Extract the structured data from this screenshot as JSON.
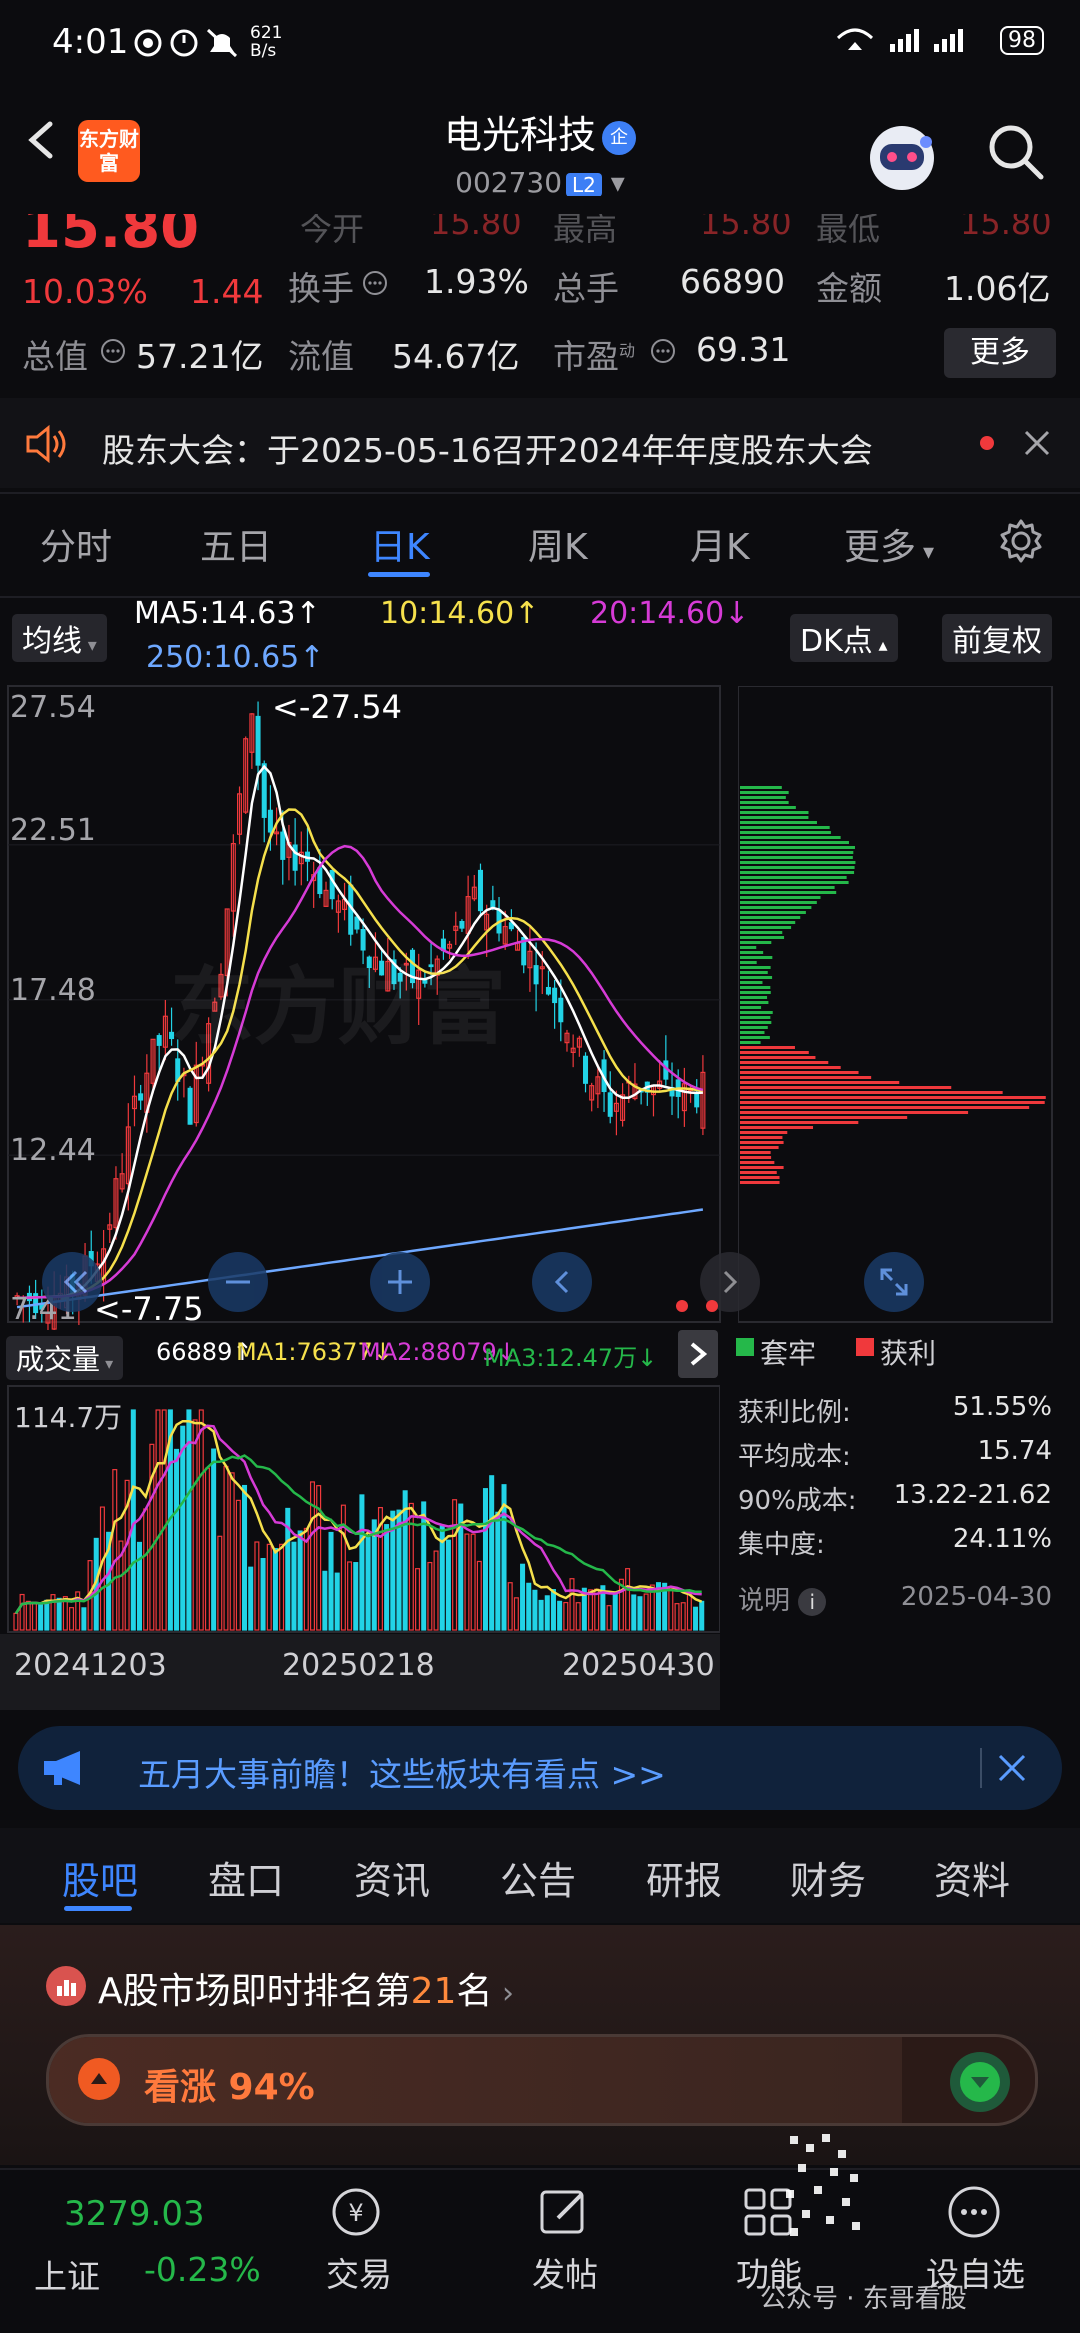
{
  "status_bar": {
    "time": "4:01",
    "speed_value": "621",
    "speed_unit": "B/s",
    "network": "4G 4G",
    "battery": "98"
  },
  "header": {
    "app_logo": "东方财富",
    "stock_name": "电光科技",
    "name_tag": "企",
    "stock_code": "002730",
    "level_tag": "L2",
    "back_icon": "chevron-left-icon",
    "robot_icon": "robot-assistant-icon",
    "search_icon": "search-icon"
  },
  "quote": {
    "price": "15.80",
    "change_pct": "10.03%",
    "change_amt": "1.44",
    "partial_row": {
      "open_label": "今开",
      "open_value": "15.80",
      "high_label": "最高",
      "high_value": "15.80",
      "low_label": "最低",
      "low_value": "15.80"
    },
    "turnover_label": "换手",
    "turnover_value": "1.93%",
    "total_vol_label": "总手",
    "total_vol_value": "66890",
    "amount_label": "金额",
    "amount_value": "1.06亿",
    "mktcap_label": "总值",
    "mktcap_value": "57.21亿",
    "float_label": "流值",
    "float_value": "54.67亿",
    "pe_label": "市盈",
    "pe_sup": "动",
    "pe_value": "69.31",
    "more_button": "更多"
  },
  "notice": {
    "text": "股东大会：于2025-05-16召开2024年年度股东大会",
    "speaker_icon": "speaker-icon",
    "close_icon": "close-icon"
  },
  "chart_tabs": {
    "items": [
      "分时",
      "五日",
      "日K",
      "周K",
      "月K",
      "更多"
    ],
    "active": "日K",
    "settings_icon": "gear-icon"
  },
  "kline": {
    "indicator_select": "均线",
    "ma5": "MA5:14.63↑",
    "ma10": "10:14.60↑",
    "ma20": "20:14.60↓",
    "ma250": "250:10.65↑",
    "dk_button": "DK点",
    "adjust_button": "前复权",
    "y_ticks": [
      "27.54",
      "22.51",
      "17.48",
      "12.44",
      "7.41"
    ],
    "high_marker": "<-27.54",
    "low_marker": "<-7.75",
    "watermark": "东方财富",
    "colors": {
      "ma5": "#ffffff",
      "ma10": "#f5e04c",
      "ma20": "#d63bd6",
      "ma250": "#6ea8ff",
      "up": "#f0393c",
      "down": "#22d3e6"
    }
  },
  "volume": {
    "select": "成交量",
    "vol": "66889↑",
    "ma1": "MA1:76377↓",
    "ma2": "MA2:88079↓",
    "ma3": "MA3:12.47万↓",
    "max_label": "114.7万",
    "dates": [
      "20241203",
      "20250218",
      "20250430"
    ]
  },
  "chip_panel": {
    "legend_loss": "套牢",
    "legend_profit": "获利",
    "rows": [
      {
        "label": "获利比例:",
        "value": "51.55%"
      },
      {
        "label": "平均成本:",
        "value": "15.74"
      },
      {
        "label": "90%成本:",
        "value": "13.22-21.62"
      },
      {
        "label": "集中度:",
        "value": "24.11%"
      }
    ],
    "note_label": "说明",
    "note_date": "2025-04-30"
  },
  "banner": {
    "text": "五月大事前瞻！这些板块有看点 >>",
    "megaphone_icon": "megaphone-icon",
    "close_icon": "close-icon"
  },
  "info_tabs": {
    "items": [
      "股吧",
      "盘口",
      "资讯",
      "公告",
      "研报",
      "财务",
      "资料"
    ],
    "active": "股吧"
  },
  "ranking": {
    "prefix": "A股市场即时排名第",
    "rank": "21",
    "suffix": "名",
    "bullish_label": "看涨 94%",
    "bullish_fraction": 0.94
  },
  "bottom_nav": {
    "index_value": "3279.03",
    "index_name": "上证",
    "index_change": "-0.23%",
    "items": [
      {
        "label": "交易",
        "icon": "trade-icon"
      },
      {
        "label": "发帖",
        "icon": "edit-icon"
      },
      {
        "label": "功能",
        "icon": "grid-icon"
      },
      {
        "label": "设自选",
        "icon": "more-dots-icon"
      }
    ],
    "watermark": "公众号 · 东哥看股"
  }
}
